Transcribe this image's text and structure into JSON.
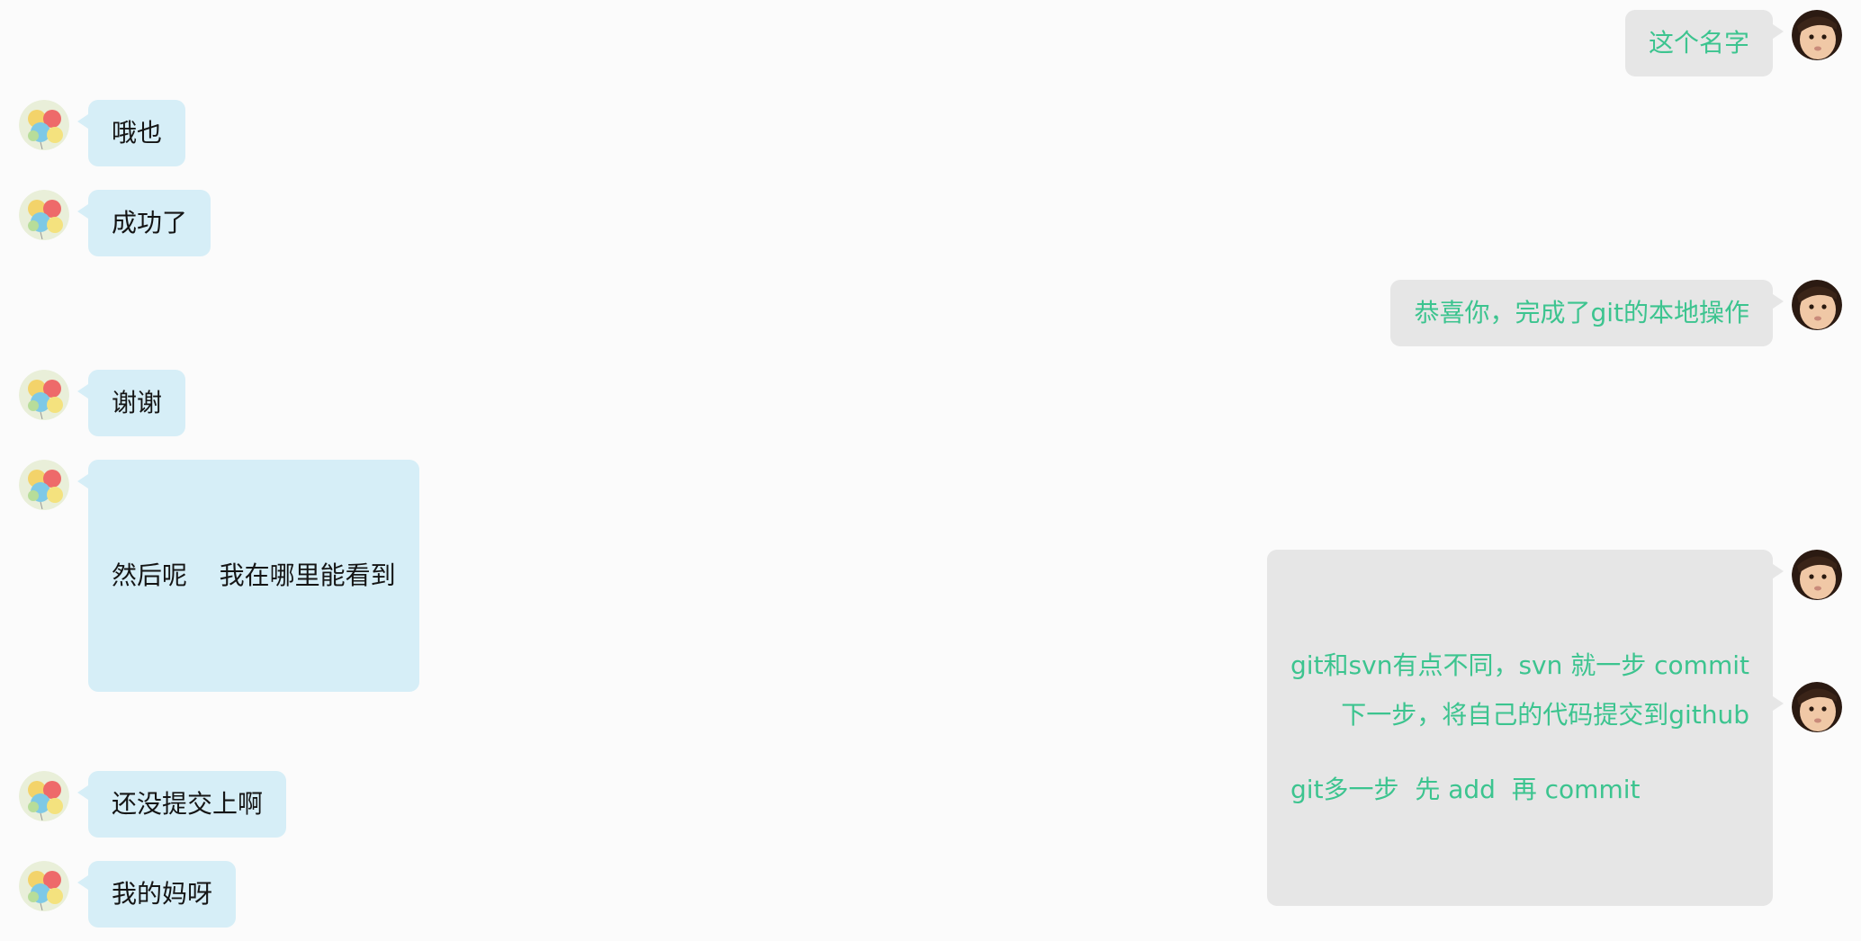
{
  "messages": [
    {
      "side": "right",
      "lines": [
        "这个名字"
      ]
    },
    {
      "side": "left",
      "lines": [
        "哦也"
      ]
    },
    {
      "side": "left",
      "lines": [
        "成功了"
      ]
    },
    {
      "side": "right",
      "lines": [
        "恭喜你，完成了git的本地操作"
      ]
    },
    {
      "side": "left",
      "lines": [
        "谢谢"
      ]
    },
    {
      "side": "left",
      "lines": [
        "然后呢    我在哪里能看到"
      ]
    },
    {
      "side": "right",
      "lines": [
        "git和svn有点不同，svn 就一步 commit",
        "git多一步  先 add  再 commit"
      ]
    },
    {
      "side": "right",
      "lines": [
        "下一步，将自己的代码提交到github"
      ]
    },
    {
      "side": "left",
      "lines": [
        "还没提交上啊"
      ]
    },
    {
      "side": "left",
      "lines": [
        "我的妈呀"
      ]
    }
  ],
  "colors": {
    "background": "#fbfbfb",
    "left_bubble": "#d6eef7",
    "left_text": "#151515",
    "right_bubble": "#e6e6e6",
    "right_text": "#3cc48f"
  },
  "icons": {
    "left_avatar": "balloons-avatar-icon",
    "right_avatar": "baby-face-avatar-icon"
  }
}
